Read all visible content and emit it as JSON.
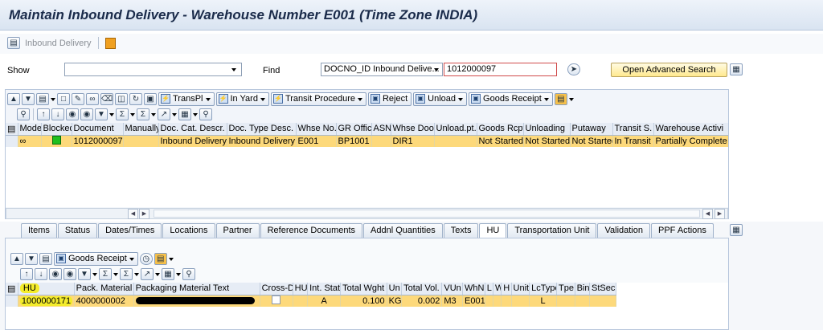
{
  "title": "Maintain Inbound Delivery - Warehouse Number E001 (Time Zone INDIA)",
  "app_toolbar": {
    "inbound_delivery_label": "Inbound Delivery"
  },
  "search": {
    "show_label": "Show",
    "show_value": "",
    "find_label": "Find",
    "find_field": "DOCNO_ID Inbound Delive...",
    "find_value": "1012000097",
    "advanced_search_label": "Open Advanced Search"
  },
  "main_toolbar": {
    "transpl": "TransPl",
    "in_yard": "In Yard",
    "transit_procedure": "Transit Procedure",
    "reject": "Reject",
    "unload": "Unload",
    "goods_receipt": "Goods Receipt"
  },
  "delivery_table": {
    "columns": [
      "Mode",
      "Blocked",
      "Document",
      "Manually",
      "Doc. Cat. Descr.",
      "Doc. Type Desc.",
      "Whse No.",
      "GR Office",
      "ASN",
      "Whse Door",
      "Unload.pt.",
      "Goods Rcpt",
      "Unloading",
      "Putaway",
      "Transit S.",
      "Warehouse Activi"
    ],
    "rows": [
      {
        "document": "1012000097",
        "manually": "",
        "doc_cat": "Inbound Delivery",
        "doc_type": "Inbound Delivery",
        "whse_no": "E001",
        "gr_office": "BP1001",
        "asn": "",
        "whse_door": "DIR1",
        "unload_pt": "",
        "goods_rcpt": "Not Started",
        "unloading": "Not Started",
        "putaway": "Not Started",
        "transit": "In Transit",
        "activity": "Partially Complete"
      }
    ]
  },
  "tabs": [
    "Items",
    "Status",
    "Dates/Times",
    "Locations",
    "Partner",
    "Reference Documents",
    "Addnl Quantities",
    "Texts",
    "HU",
    "Transportation Unit",
    "Validation",
    "PPF Actions"
  ],
  "active_tab": "HU",
  "hu_toolbar": {
    "goods_receipt": "Goods Receipt"
  },
  "hu_table": {
    "columns": [
      "HU",
      "Pack. Material",
      "Packaging Material Text",
      "Cross-D",
      "HU",
      "Int. Stat.",
      "Total Wght",
      "Un",
      "Total Vol.",
      "VUn",
      "WhN",
      "L",
      "W",
      "H",
      "Unit",
      "LcType",
      "Tpe",
      "Bin",
      "StSec"
    ],
    "rows": [
      {
        "hu": "1000000171",
        "pack_material": "4000000002",
        "int_stat": "A",
        "total_wght": "0.100",
        "un": "KG",
        "total_vol": "0.002",
        "vun": "M3",
        "whn": "E001",
        "lctype": "L"
      }
    ]
  },
  "colors": {
    "row_highlight": "#fdd97b",
    "hu_highlight": "#f4ec2b",
    "title": "#1a2b4a"
  }
}
